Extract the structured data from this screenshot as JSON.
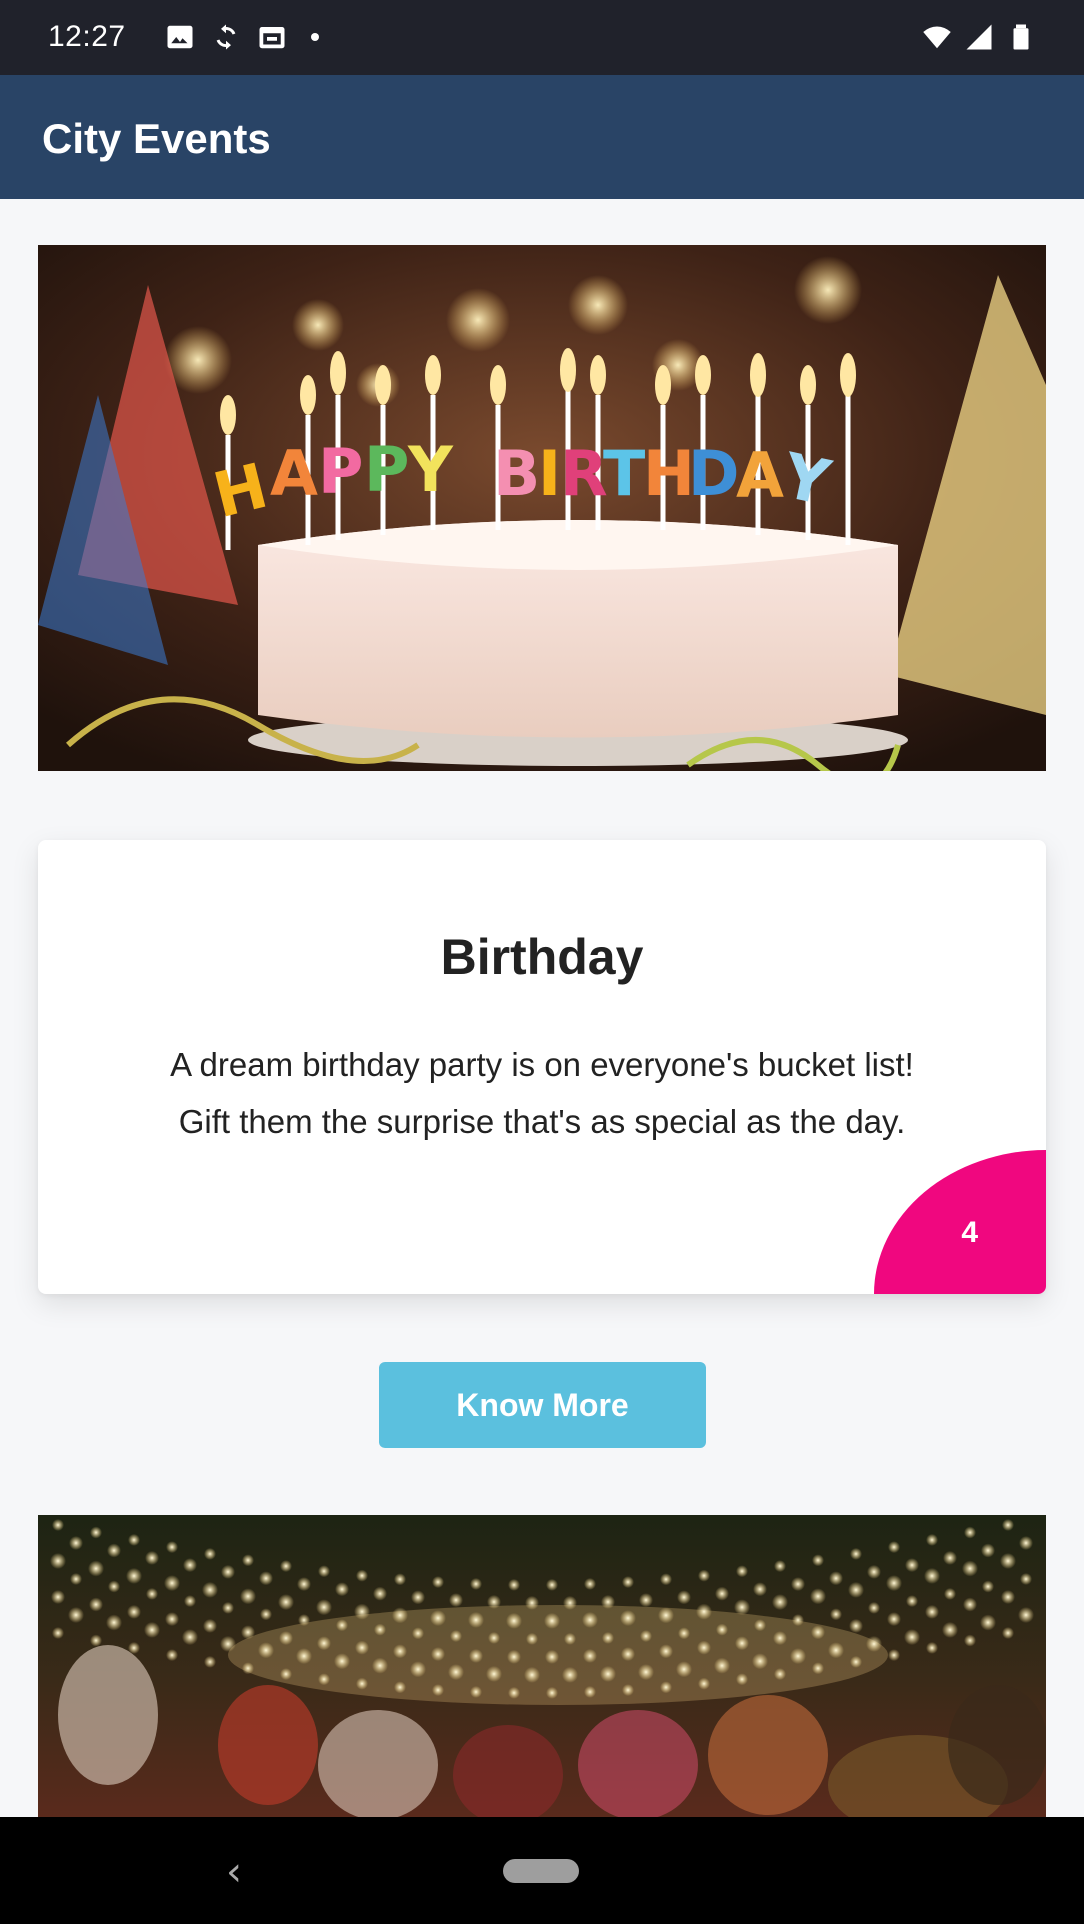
{
  "status_bar": {
    "time": "12:27",
    "icons_left": [
      "image-icon",
      "sync-icon",
      "calendar-icon"
    ],
    "icons_right": [
      "wifi-icon",
      "signal-icon",
      "battery-icon"
    ]
  },
  "app_bar": {
    "title": "City Events"
  },
  "events": [
    {
      "image": "birthday-cake-photo",
      "title": "Birthday",
      "description": "A dream birthday party is on everyone's bucket list! Gift them the surprise that's as special as the day.",
      "badge": "4",
      "button_label": "Know More"
    },
    {
      "image": "string-lights-party-photo"
    }
  ],
  "nav_bar": {
    "back_icon": "chevron-left-icon",
    "home_icon": "home-pill-icon"
  },
  "colors": {
    "status_bar": "#20222b",
    "app_bar": "#294466",
    "badge": "#f0077f",
    "button": "#5bc0de",
    "background": "#f6f7f9"
  }
}
